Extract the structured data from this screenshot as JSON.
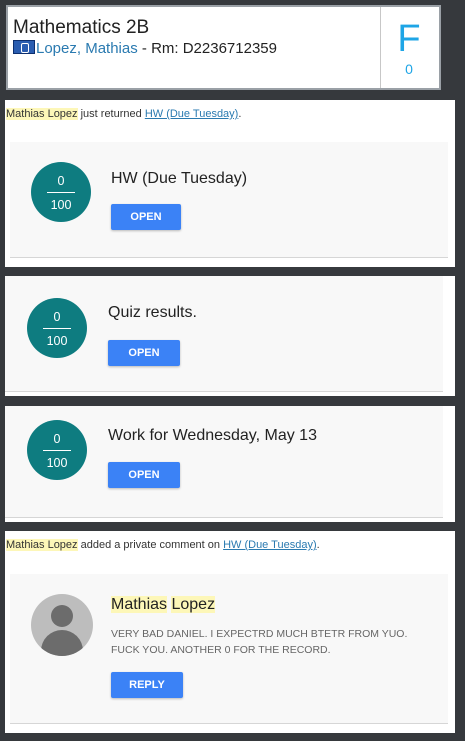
{
  "header": {
    "course_title": "Mathematics 2B",
    "teacher_name": "Lopez, Mathias",
    "room_label": " - Rm: D2236712359",
    "grade_letter": "F",
    "grade_count": "0"
  },
  "feed": [
    {
      "notice": {
        "actor": "Mathias Lopez",
        "action": " just returned ",
        "link": "HW (Due Tuesday)",
        "end": "."
      },
      "score": {
        "numerator": "0",
        "denominator": "100"
      },
      "title": "HW (Due Tuesday)",
      "button": "OPEN"
    },
    {
      "score": {
        "numerator": "0",
        "denominator": "100"
      },
      "title": "Quiz results.",
      "button": "OPEN"
    },
    {
      "score": {
        "numerator": "0",
        "denominator": "100"
      },
      "title": "Work for Wednesday, May 13",
      "button": "OPEN"
    }
  ],
  "comment": {
    "notice": {
      "actor": "Mathias Lopez",
      "action": " added a private comment on ",
      "link": "HW (Due Tuesday)",
      "end": "."
    },
    "author_first": "Mathias",
    "author_last": "Lopez",
    "body": "VERY BAD DANIEL. I EXPECTRD MUCH BTETR FROM YUO. FUCK YOU. ANOTHER 0 FOR THE RECORD.",
    "button": "REPLY"
  }
}
